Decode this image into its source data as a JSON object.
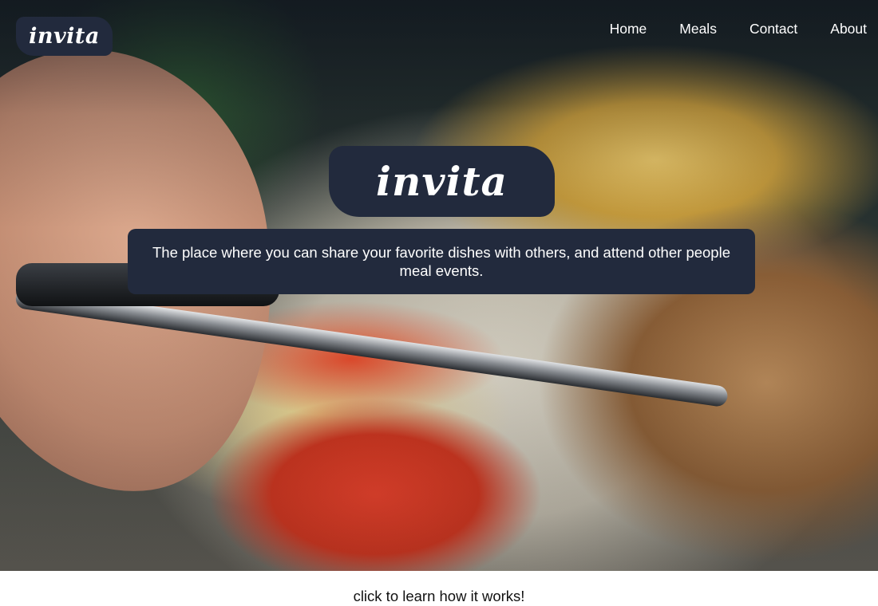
{
  "brand": {
    "logo_text": "invita"
  },
  "nav": {
    "items": [
      {
        "label": "Home"
      },
      {
        "label": "Meals"
      },
      {
        "label": "Contact"
      },
      {
        "label": "About"
      }
    ]
  },
  "hero": {
    "logo_text": "invita",
    "tagline": "The place where you can share your favorite dishes with others, and attend other people meal events."
  },
  "cta": {
    "label": "click to learn how it works!"
  },
  "colors": {
    "primary_dark": "#222a3d",
    "text_light": "#ffffff"
  }
}
